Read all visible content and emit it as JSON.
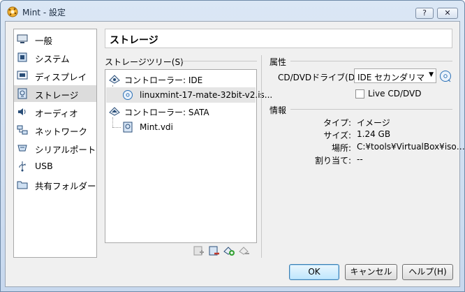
{
  "window": {
    "title": "Mint - 設定",
    "help_label": "?",
    "close_label": "✕"
  },
  "sidebar": {
    "items": [
      {
        "label": "一般",
        "icon": "monitor-icon"
      },
      {
        "label": "システム",
        "icon": "chip-icon"
      },
      {
        "label": "ディスプレイ",
        "icon": "display-icon"
      },
      {
        "label": "ストレージ",
        "icon": "storage-icon",
        "selected": true
      },
      {
        "label": "オーディオ",
        "icon": "speaker-icon"
      },
      {
        "label": "ネットワーク",
        "icon": "network-icon"
      },
      {
        "label": "シリアルポート",
        "icon": "serial-icon"
      },
      {
        "label": "USB",
        "icon": "usb-icon"
      },
      {
        "label": "共有フォルダー",
        "icon": "folder-icon"
      }
    ]
  },
  "page": {
    "title": "ストレージ"
  },
  "storage_tree": {
    "section_label": "ストレージツリー(S)",
    "controllers": [
      {
        "label": "コントローラー: IDE",
        "attachments": [
          {
            "label": "linuxmint-17-mate-32bit-v2.is...",
            "type": "cd"
          }
        ]
      },
      {
        "label": "コントローラー: SATA",
        "attachments": [
          {
            "label": "Mint.vdi",
            "type": "disk"
          }
        ]
      }
    ],
    "tools": [
      "add-attachment-icon",
      "remove-attachment-icon",
      "add-controller-icon",
      "remove-controller-icon"
    ]
  },
  "attributes": {
    "section_label": "属性",
    "drive_label": "CD/DVDドライブ(D):",
    "drive_value": "IDE セカンダリマスタ",
    "live_cd_label": "Live CD/DVD",
    "live_cd_checked": false
  },
  "info": {
    "section_label": "情報",
    "rows": [
      {
        "label": "タイプ:",
        "value": "イメージ"
      },
      {
        "label": "サイズ:",
        "value": "1.24 GB"
      },
      {
        "label": "場所:",
        "value": "C:¥tools¥VirtualBox¥iso…"
      },
      {
        "label": "割り当て:",
        "value": "--"
      }
    ]
  },
  "buttons": {
    "ok": "OK",
    "cancel": "キャンセル",
    "help": "ヘルプ(H)"
  }
}
